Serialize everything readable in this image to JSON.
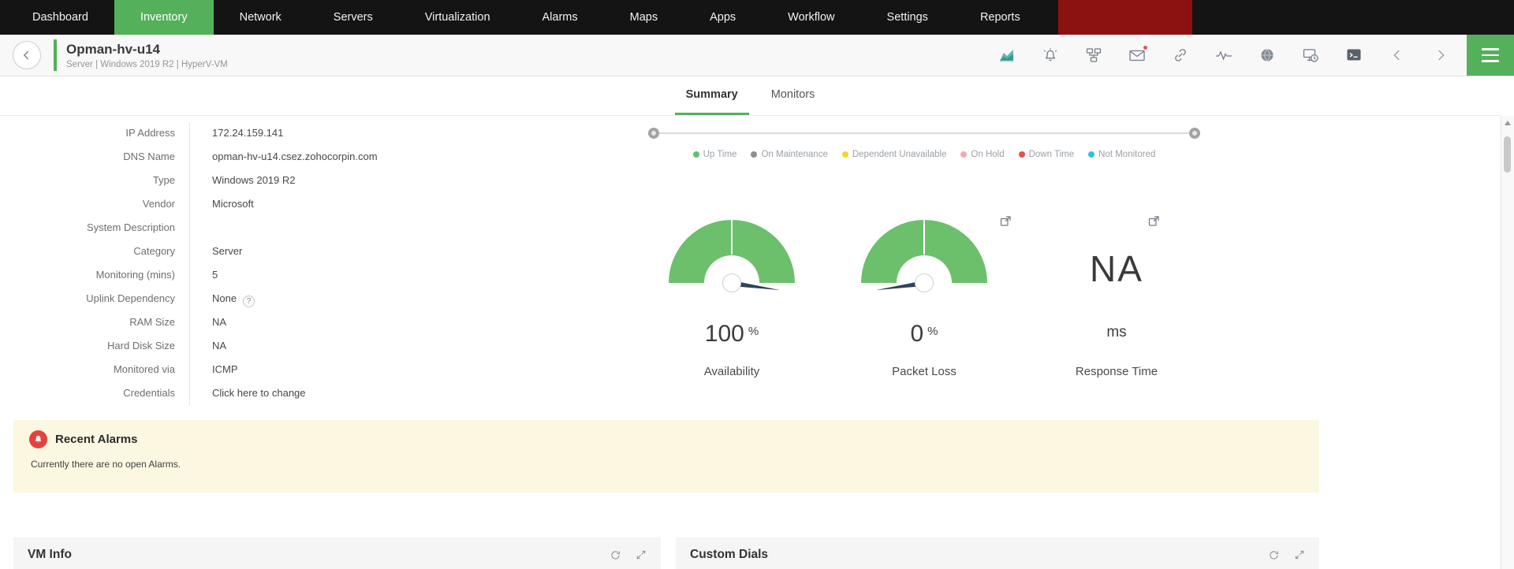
{
  "nav": {
    "items": [
      {
        "label": "Dashboard"
      },
      {
        "label": "Inventory"
      },
      {
        "label": "Network"
      },
      {
        "label": "Servers"
      },
      {
        "label": "Virtualization"
      },
      {
        "label": "Alarms"
      },
      {
        "label": "Maps"
      },
      {
        "label": "Apps"
      },
      {
        "label": "Workflow"
      },
      {
        "label": "Settings"
      },
      {
        "label": "Reports"
      }
    ],
    "active_item": "Inventory",
    "promo_color": "#8c1212"
  },
  "header": {
    "title": "Opman-hv-u14",
    "subtitle": "Server | Windows 2019 R2 | HyperV-VM",
    "icons": [
      "chart-icon",
      "alarm-bell-icon",
      "workflow-icon",
      "mail-icon",
      "link-icon",
      "traffic-pulse-icon",
      "globe-icon",
      "device-schedule-icon",
      "terminal-icon",
      "prev-device-icon",
      "next-device-icon",
      "menu-icon"
    ]
  },
  "tabs": [
    {
      "label": "Summary",
      "active": true
    },
    {
      "label": "Monitors",
      "active": false
    }
  ],
  "details": {
    "rows": [
      {
        "label": "IP Address",
        "value": "172.24.159.141"
      },
      {
        "label": "DNS Name",
        "value": "opman-hv-u14.csez.zohocorpin.com"
      },
      {
        "label": "Type",
        "value": "Windows 2019 R2"
      },
      {
        "label": "Vendor",
        "value": "Microsoft"
      },
      {
        "label": "System Description",
        "value": ""
      },
      {
        "label": "Category",
        "value": "Server"
      },
      {
        "label": "Monitoring (mins)",
        "value": "5"
      },
      {
        "label": "Uplink Dependency",
        "value": "None",
        "help": "?"
      },
      {
        "label": "RAM Size",
        "value": "NA"
      },
      {
        "label": "Hard Disk Size",
        "value": "NA"
      },
      {
        "label": "Monitored via",
        "value": "ICMP"
      },
      {
        "label": "Credentials",
        "value": "Click here to change"
      }
    ]
  },
  "timeline": {
    "legend": [
      {
        "label": "Up Time",
        "color": "#5fbf6e"
      },
      {
        "label": "On Maintenance",
        "color": "#8f8f8f"
      },
      {
        "label": "Dependent Unavailable",
        "color": "#f6d32d"
      },
      {
        "label": "On Hold",
        "color": "#f4a7b4"
      },
      {
        "label": "Down Time",
        "color": "#e8504a"
      },
      {
        "label": "Not Monitored",
        "color": "#30bfe8"
      }
    ]
  },
  "gauges": [
    {
      "value": "100",
      "unit": "%",
      "label": "Availability",
      "percent": 100
    },
    {
      "value": "0",
      "unit": "%",
      "label": "Packet Loss",
      "percent": 0
    },
    {
      "value": "NA",
      "unit": "ms",
      "label": "Response Time",
      "percent": null
    }
  ],
  "alarms": {
    "title": "Recent Alarms",
    "empty_message": "Currently there are no open Alarms."
  },
  "panels": [
    {
      "title": "VM Info"
    },
    {
      "title": "Custom Dials"
    }
  ],
  "colors": {
    "accent_green": "#54b05a",
    "gauge_green": "#6cc06b",
    "needle_navy": "#2f4358",
    "alarm_red": "#e5413f",
    "nav_bg": "#141414",
    "alarm_panel_bg": "#fcf7e1"
  }
}
